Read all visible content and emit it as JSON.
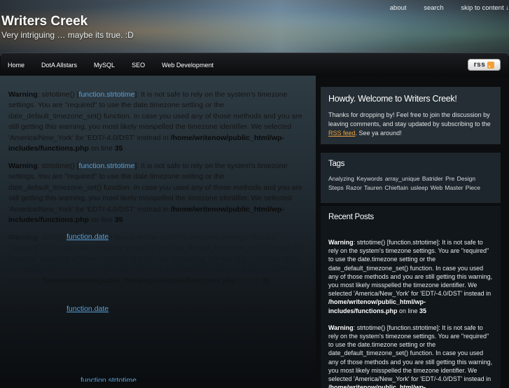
{
  "header": {
    "site_title": "Writers Creek",
    "tagline": "Very intriguing … maybe its true. :D",
    "top_links": [
      "about",
      "search",
      "skip to content ↓"
    ]
  },
  "nav": {
    "items": [
      "Home",
      "DotA Allstars",
      "MySQL",
      "SEO",
      "Web Development"
    ],
    "rss_label": "rss"
  },
  "warning": {
    "label": "Warning",
    "fn_strtotime": "function.strtotime",
    "fn_date": "function.date",
    "message": ": It is not safe to rely on the system's timezone settings. You are \"required\" to use the date.timezone setting or the date_default_timezone_set() function. In case you used any of those methods and you are still getting this warning, you most likely misspelled the timezone identifier. We selected 'America/New_York' for 'EDT/-4.0/DST' instead in ",
    "path": "/home/writenow/public_html/wp-includes/functions.php",
    "on_line": " on line ",
    "line": "35"
  },
  "sidebar": {
    "welcome": {
      "title": "Howdy. Welcome to Writers Creek!",
      "text_before": "Thanks for dropping by! Feel free to join the discussion by leaving comments, and stay updated by subscribing to the ",
      "rss_link": "RSS feed",
      "text_after": ". See ya around!"
    },
    "tags": {
      "title": "Tags",
      "items": [
        "Analyzing Keywords",
        "array_unique",
        "Batrider",
        "Pre Design Steps",
        "Razor",
        "Tauren Chieftain",
        "usleep",
        "Web Master Piece"
      ]
    },
    "recent_posts": {
      "title": "Recent Posts",
      "entry_label": "Warning",
      "entry_fn": "strtotime()",
      "entry_fn_link": "[function.strtotime]"
    }
  },
  "colors": {
    "link": "#5aa0d8",
    "rss_orange": "#f0a040",
    "nav_bg": "#0a0b0c"
  }
}
